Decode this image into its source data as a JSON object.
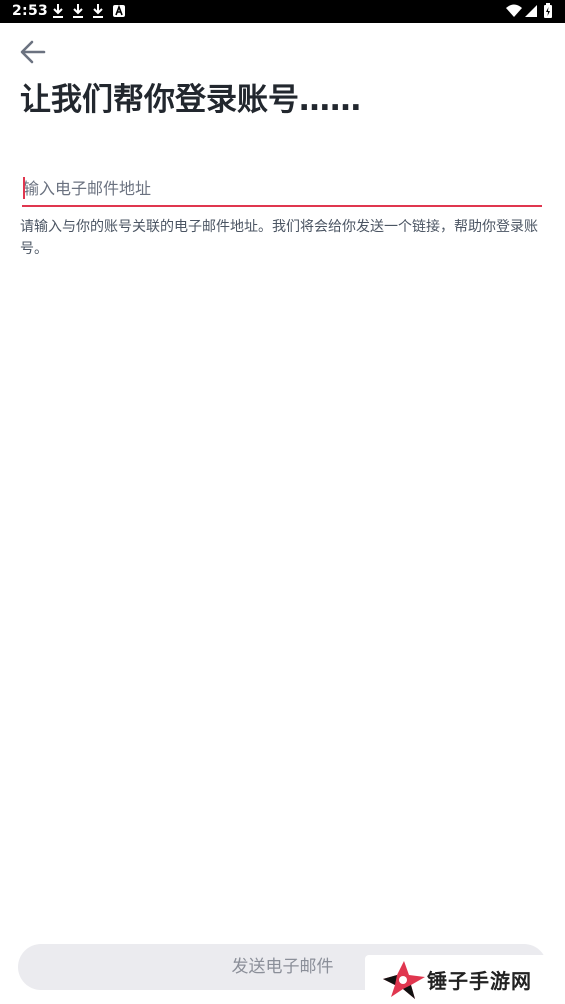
{
  "status_bar": {
    "time": "2:53",
    "icons": [
      "download-icon",
      "download-icon",
      "download-icon",
      "font-icon",
      "wifi-icon",
      "signal-icon",
      "battery-icon"
    ]
  },
  "header": {
    "back_icon": "arrow-left-icon",
    "title": "让我们帮你登录账号……"
  },
  "email": {
    "placeholder": "输入电子邮件地址",
    "value": "",
    "helper": "请输入与你的账号关联的电子邮件地址。我们将会给你发送一个链接，帮助你登录账号。"
  },
  "footer": {
    "send_label": "发送电子邮件"
  },
  "watermark": {
    "text": "锤子手游网"
  },
  "colors": {
    "accent": "#e0364f",
    "button_bg": "#ebebef",
    "button_text": "#8b8f99",
    "title": "#22272e"
  }
}
